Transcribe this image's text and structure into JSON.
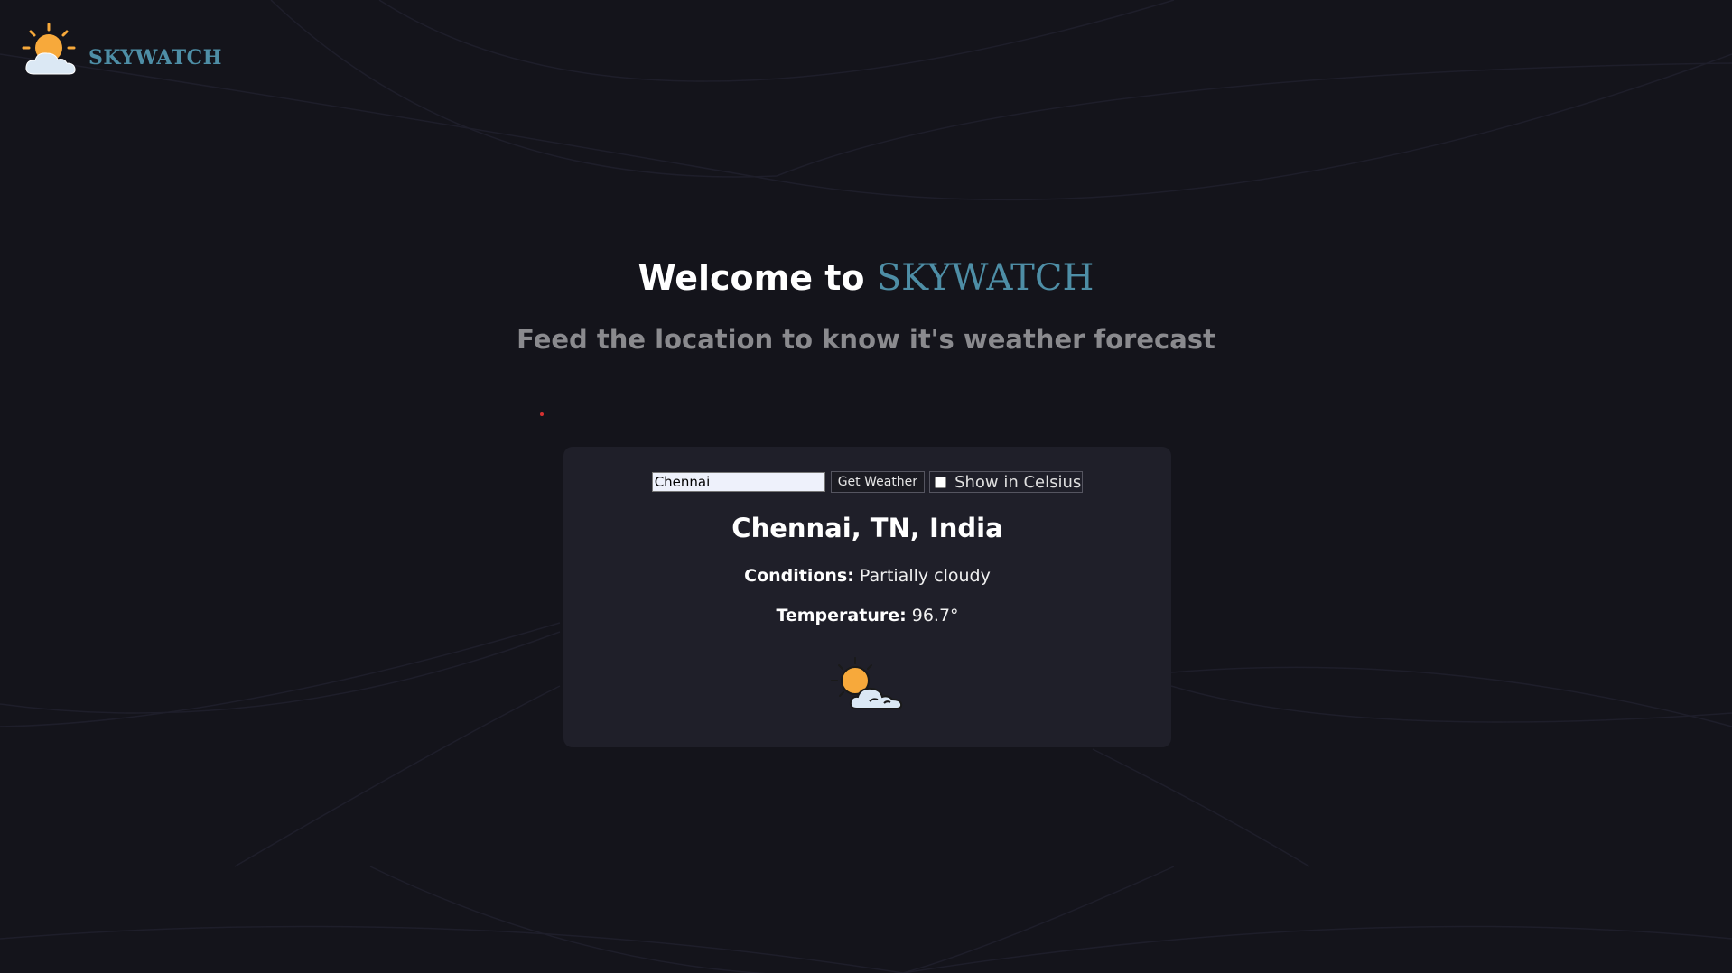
{
  "brand": {
    "name": "SKYWATCH",
    "logo_icon": "sun-behind-cloud-icon"
  },
  "hero": {
    "title_prefix": "Welcome to ",
    "title_accent": "SKYWATCH",
    "subtitle": "Feed the location to know it's weather forecast"
  },
  "search": {
    "value": "Chennai",
    "button_label": "Get Weather",
    "celsius_label": "Show in Celsius",
    "celsius_checked": false
  },
  "weather": {
    "location": "Chennai, TN, India",
    "conditions_label": "Conditions:",
    "conditions_value": "Partially cloudy",
    "temperature_label": "Temperature:",
    "temperature_value": "96.7°",
    "icon": "partly-cloudy-icon"
  },
  "colors": {
    "background": "#14141b",
    "card": "#1f1f29",
    "accent": "#4e8ea6",
    "subtitle": "#8a8a8e",
    "sun": "#f7a93b",
    "cloud": "#dbe8f4"
  }
}
